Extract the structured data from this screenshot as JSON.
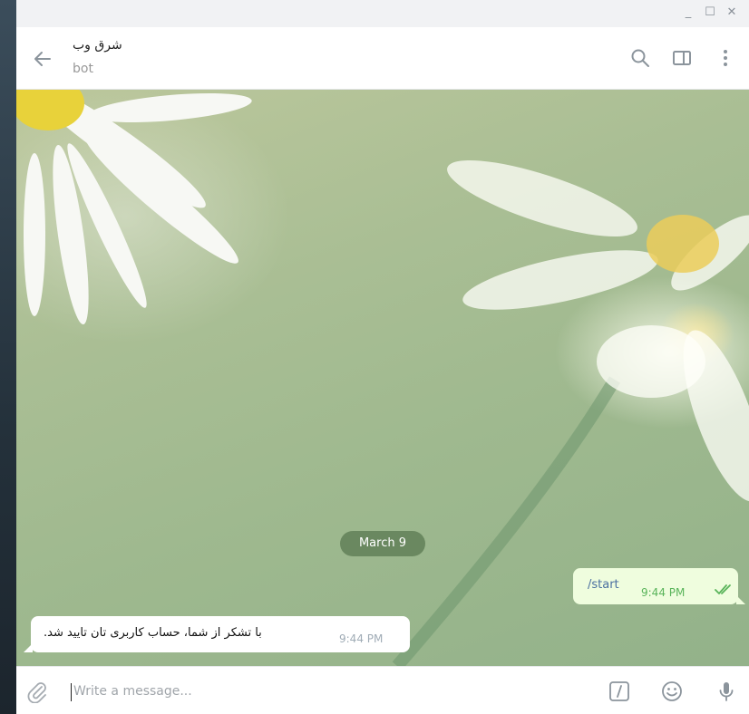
{
  "window_controls": {
    "minimize": "_",
    "maximize": "☐",
    "close": "✕"
  },
  "header": {
    "title": "شرق وب",
    "subtitle": "bot"
  },
  "chat": {
    "date_separator": "March 9",
    "messages": [
      {
        "direction": "out",
        "text": "/start",
        "time": "9:44 PM",
        "status": "read"
      },
      {
        "direction": "in",
        "text": "با تشکر از شما، حساب کاربری تان تایید شد.",
        "time": "9:44 PM"
      }
    ]
  },
  "composer": {
    "placeholder": "Write a message..."
  },
  "icons": {
    "back": "arrow-left-icon",
    "search": "search-icon",
    "sidebar": "sidebar-toggle-icon",
    "more": "more-vertical-icon",
    "attach": "paperclip-icon",
    "commands": "slash-command-icon",
    "emoji": "emoji-icon",
    "mic": "microphone-icon"
  },
  "colors": {
    "accent": "#4a90c8",
    "outgoing_bubble": "#effdde",
    "read_ticks": "#59b45a",
    "date_pill": "#5a7850"
  }
}
